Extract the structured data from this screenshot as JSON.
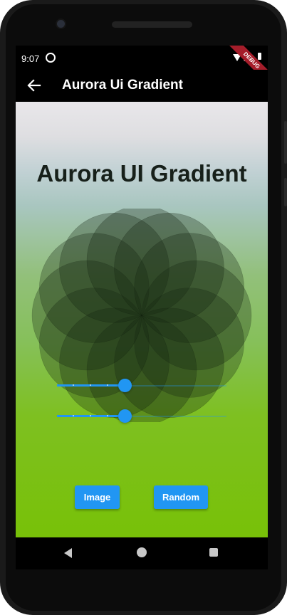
{
  "status_bar": {
    "time": "9:07",
    "debug_banner": "DEBUG"
  },
  "app_bar": {
    "title": "Aurora Ui Gradient"
  },
  "main": {
    "heading": "Aurora UI Gradient",
    "sliders": [
      {
        "name": "slider-1",
        "value": 0.4
      },
      {
        "name": "slider-2",
        "value": 0.4
      }
    ],
    "buttons": {
      "image_label": "Image",
      "random_label": "Random"
    }
  },
  "colors": {
    "accent": "#2196f3",
    "debug": "#a51d2a"
  }
}
